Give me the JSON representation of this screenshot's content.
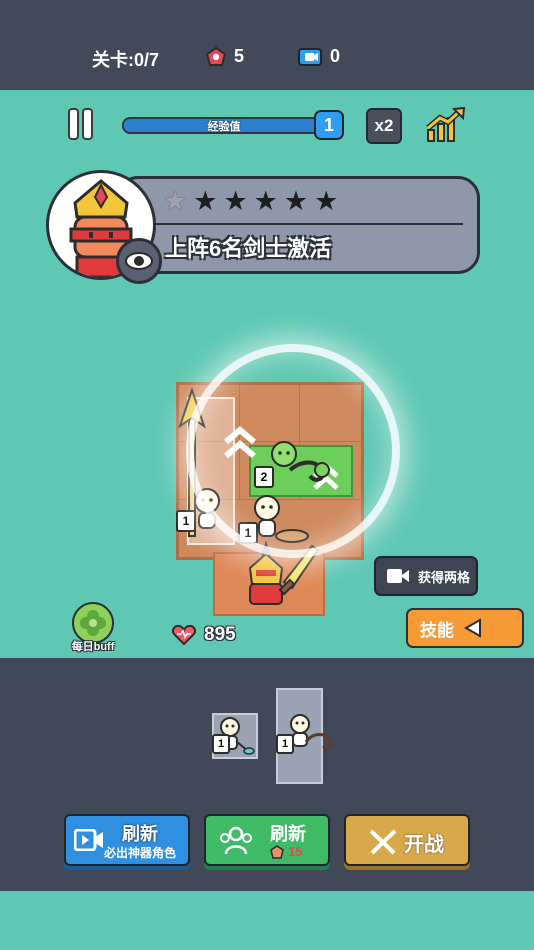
{
  "topbar": {
    "level": "关卡:0/7",
    "gems": "5",
    "tickets": "0"
  },
  "hud": {
    "xp_label": "经验值",
    "xp_fraction": 1.0,
    "level_badge": "1",
    "speed_label": "x2",
    "icons": [
      "pause-icon",
      "trend-up-icon"
    ]
  },
  "quest": {
    "stars_lit": 1,
    "stars_total": 6,
    "text": "上阵6名剑士激活"
  },
  "battle": {
    "video_button": "获得两格",
    "skill_button": "技能",
    "daily_buff": "每日buff",
    "health": "895",
    "unit_levels": [
      "1",
      "2",
      "1"
    ]
  },
  "shop": {
    "card_levels": [
      "1",
      "1"
    ],
    "refresh_video": {
      "title": "刷新",
      "subtitle": "必出神器角色"
    },
    "refresh_gem": {
      "title": "刷新",
      "cost": "15"
    },
    "start_battle": "开战"
  },
  "colors": {
    "sea": "#5ec8b3",
    "panel": "#414958",
    "blue_button": "#2f8fe0",
    "green_button": "#3fba66",
    "orange_button": "#f59a35",
    "gold_button": "#d9a84a"
  }
}
